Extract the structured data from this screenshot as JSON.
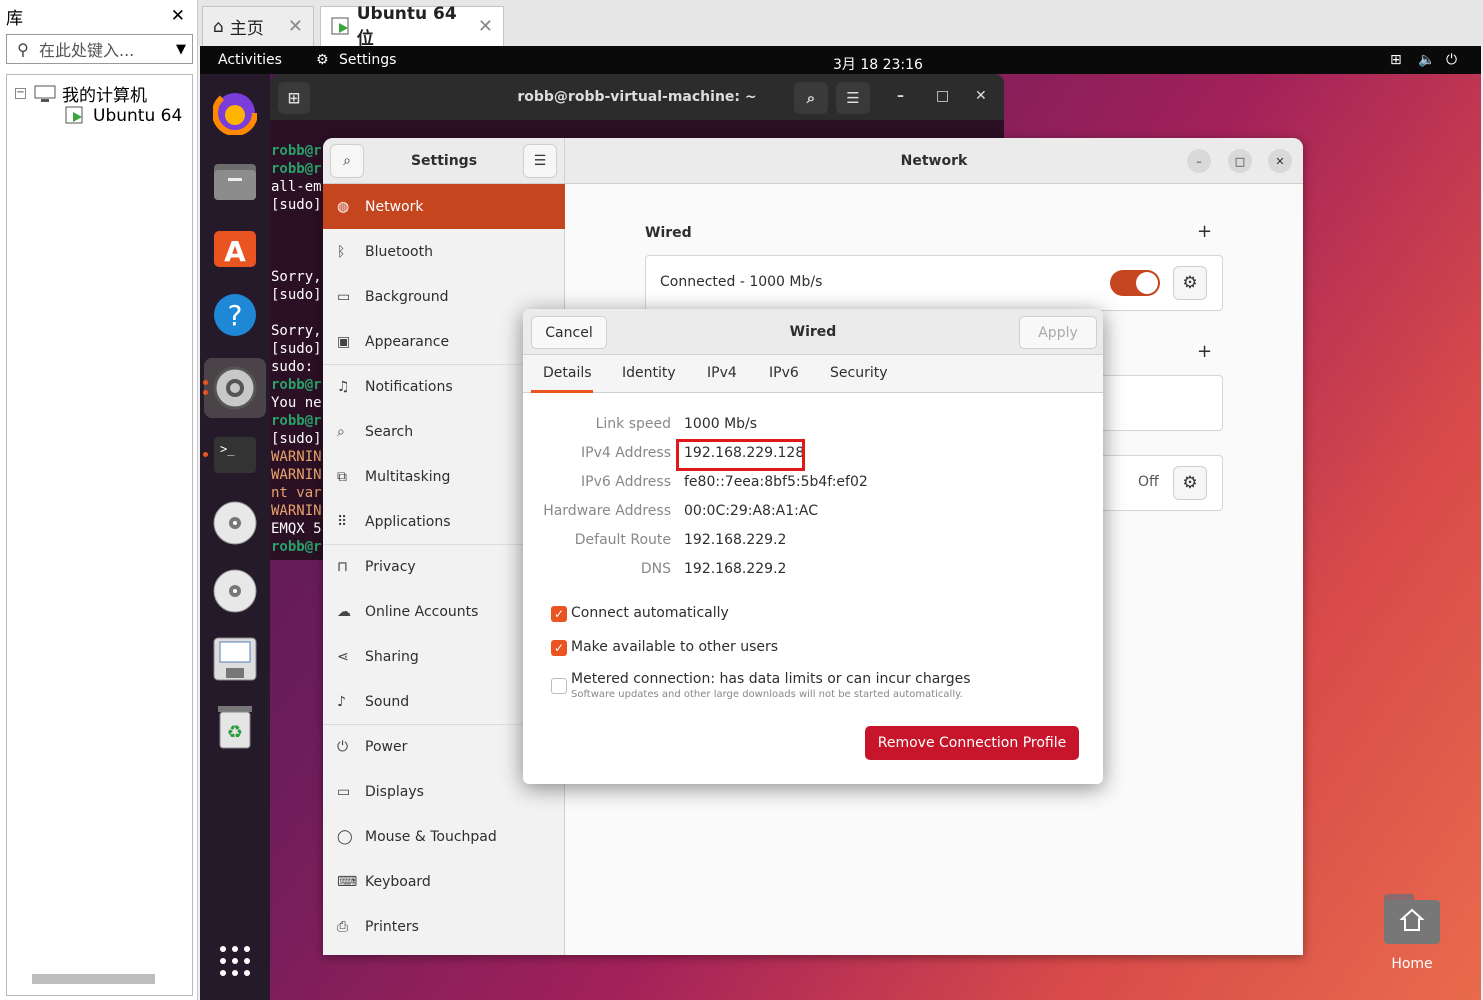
{
  "library": {
    "title": "库",
    "search_placeholder": "在此处键入...",
    "tree_root": "我的计算机",
    "tree_vm": "Ubuntu 64"
  },
  "tabs": [
    {
      "label": "主页"
    },
    {
      "label": "Ubuntu 64 位"
    }
  ],
  "topbar": {
    "activities": "Activities",
    "app": "Settings",
    "clock": "3月 18  23:16"
  },
  "terminal": {
    "title": "robb@robb-virtual-machine: ~",
    "lines": [
      {
        "t": "robb@r",
        "c": "g"
      },
      {
        "t": "robb@r",
        "c": "g"
      },
      {
        "t": "all-em",
        "c": ""
      },
      {
        "t": "[sudo]",
        "c": ""
      },
      {
        "t": "",
        "c": ""
      },
      {
        "t": "",
        "c": ""
      },
      {
        "t": "",
        "c": ""
      },
      {
        "t": "Sorry,",
        "c": ""
      },
      {
        "t": "[sudo]",
        "c": ""
      },
      {
        "t": "",
        "c": ""
      },
      {
        "t": "Sorry,",
        "c": ""
      },
      {
        "t": "[sudo]",
        "c": ""
      },
      {
        "t": "sudo:",
        "c": ""
      },
      {
        "t": "robb@r",
        "c": "g"
      },
      {
        "t": "You ne",
        "c": ""
      },
      {
        "t": "robb@r",
        "c": "g"
      },
      {
        "t": "[sudo]",
        "c": ""
      },
      {
        "t": "WARNIN",
        "c": "o"
      },
      {
        "t": "WARNIN",
        "c": "o"
      },
      {
        "t": "nt var",
        "c": "o"
      },
      {
        "t": "WARNIN",
        "c": "o"
      },
      {
        "t": "EMQX 5",
        "c": ""
      },
      {
        "t": "robb@r",
        "c": "g"
      }
    ]
  },
  "settings": {
    "sidebar_title": "Settings",
    "page_title": "Network",
    "sidebar": [
      {
        "label": "Network",
        "icon": "network-icon",
        "glyph": "◍"
      },
      {
        "label": "Bluetooth",
        "icon": "bluetooth-icon",
        "glyph": "ᛒ"
      },
      {
        "label": "Background",
        "icon": "background-icon",
        "glyph": "▭"
      },
      {
        "label": "Appearance",
        "icon": "appearance-icon",
        "glyph": "▣"
      },
      {
        "label": "Notifications",
        "icon": "notifications-icon",
        "glyph": "♫"
      },
      {
        "label": "Search",
        "icon": "search-icon",
        "glyph": "⌕"
      },
      {
        "label": "Multitasking",
        "icon": "multitasking-icon",
        "glyph": "⧉"
      },
      {
        "label": "Applications",
        "icon": "applications-icon",
        "glyph": "⠿"
      },
      {
        "label": "Privacy",
        "icon": "privacy-icon",
        "glyph": "⊓"
      },
      {
        "label": "Online Accounts",
        "icon": "cloud-icon",
        "glyph": "☁"
      },
      {
        "label": "Sharing",
        "icon": "sharing-icon",
        "glyph": "⋖"
      },
      {
        "label": "Sound",
        "icon": "sound-icon",
        "glyph": "♪"
      },
      {
        "label": "Power",
        "icon": "power-icon",
        "glyph": "⏻"
      },
      {
        "label": "Displays",
        "icon": "displays-icon",
        "glyph": "▭"
      },
      {
        "label": "Mouse & Touchpad",
        "icon": "mouse-icon",
        "glyph": "◯"
      },
      {
        "label": "Keyboard",
        "icon": "keyboard-icon",
        "glyph": "⌨"
      },
      {
        "label": "Printers",
        "icon": "printer-icon",
        "glyph": "⎙"
      }
    ],
    "wired_section": "Wired",
    "wired_status": "Connected - 1000 Mb/s",
    "second_status": "Off"
  },
  "dialog": {
    "title": "Wired",
    "cancel": "Cancel",
    "apply": "Apply",
    "tabs": [
      "Details",
      "Identity",
      "IPv4",
      "IPv6",
      "Security"
    ],
    "details": [
      {
        "key": "Link speed",
        "value": "1000 Mb/s"
      },
      {
        "key": "IPv4 Address",
        "value": "192.168.229.128"
      },
      {
        "key": "IPv6 Address",
        "value": "fe80::7eea:8bf5:5b4f:ef02"
      },
      {
        "key": "Hardware Address",
        "value": "00:0C:29:A8:A1:AC"
      },
      {
        "key": "Default Route",
        "value": "192.168.229.2"
      },
      {
        "key": "DNS",
        "value": "192.168.229.2"
      }
    ],
    "connect_auto": "Connect automatically",
    "available_all": "Make available to other users",
    "metered": "Metered connection: has data limits or can incur charges",
    "metered_sub": "Software updates and other large downloads will not be started automatically.",
    "remove": "Remove Connection Profile"
  },
  "desktop": {
    "home_label": "Home"
  },
  "colors": {
    "accent": "#e95420",
    "selected": "#c5451f",
    "danger": "#c7162b"
  }
}
